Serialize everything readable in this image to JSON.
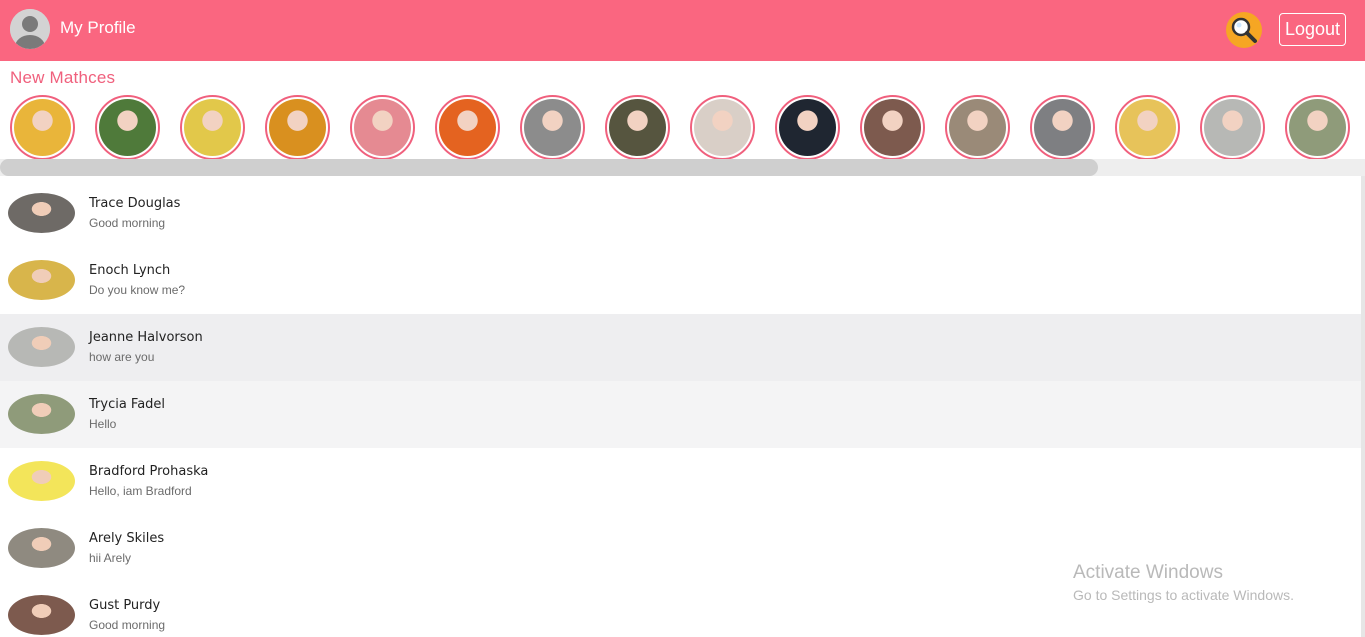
{
  "header": {
    "profile_label": "My Profile",
    "logout_label": "Logout",
    "bg_color": "#fa6680",
    "search_color": "#f6a623"
  },
  "matches": {
    "title": "New Mathces",
    "avatars": [
      {
        "icon": "match-avatar-1",
        "color": "#e9b53a"
      },
      {
        "icon": "match-avatar-2",
        "color": "#4f7a3a"
      },
      {
        "icon": "match-avatar-3",
        "color": "#e2c84a"
      },
      {
        "icon": "match-avatar-4",
        "color": "#d9901f"
      },
      {
        "icon": "match-avatar-5",
        "color": "#e58a92"
      },
      {
        "icon": "match-avatar-6",
        "color": "#e46320"
      },
      {
        "icon": "match-avatar-7",
        "color": "#8c8c8c"
      },
      {
        "icon": "match-avatar-8",
        "color": "#56553f"
      },
      {
        "icon": "match-avatar-9",
        "color": "#d9cfc7"
      },
      {
        "icon": "match-avatar-10",
        "color": "#1f2631"
      },
      {
        "icon": "match-avatar-11",
        "color": "#7d5a4e"
      },
      {
        "icon": "match-avatar-12",
        "color": "#9a8a78"
      },
      {
        "icon": "match-avatar-13",
        "color": "#7e7f82"
      },
      {
        "icon": "match-avatar-14",
        "color": "#e7c35a"
      },
      {
        "icon": "match-avatar-15",
        "color": "#b7b8b5"
      },
      {
        "icon": "match-avatar-16",
        "color": "#8f9b7a"
      }
    ]
  },
  "chats": [
    {
      "name": "Trace Douglas",
      "message": "Good morning",
      "color": "#6e6a66"
    },
    {
      "name": "Enoch Lynch",
      "message": "Do you know me?",
      "color": "#d8b54b"
    },
    {
      "name": "Jeanne Halvorson",
      "message": "how are you",
      "color": "#b7b8b5"
    },
    {
      "name": "Trycia Fadel",
      "message": "Hello",
      "color": "#8f9b7a"
    },
    {
      "name": "Bradford Prohaska",
      "message": "Hello, iam Bradford",
      "color": "#f3e55a"
    },
    {
      "name": "Arely Skiles",
      "message": "hii Arely",
      "color": "#8f8a80"
    },
    {
      "name": "Gust Purdy",
      "message": "Good morning",
      "color": "#7d5a4e"
    }
  ],
  "watermark": {
    "title": "Activate Windows",
    "subtitle": "Go to Settings to activate Windows."
  }
}
